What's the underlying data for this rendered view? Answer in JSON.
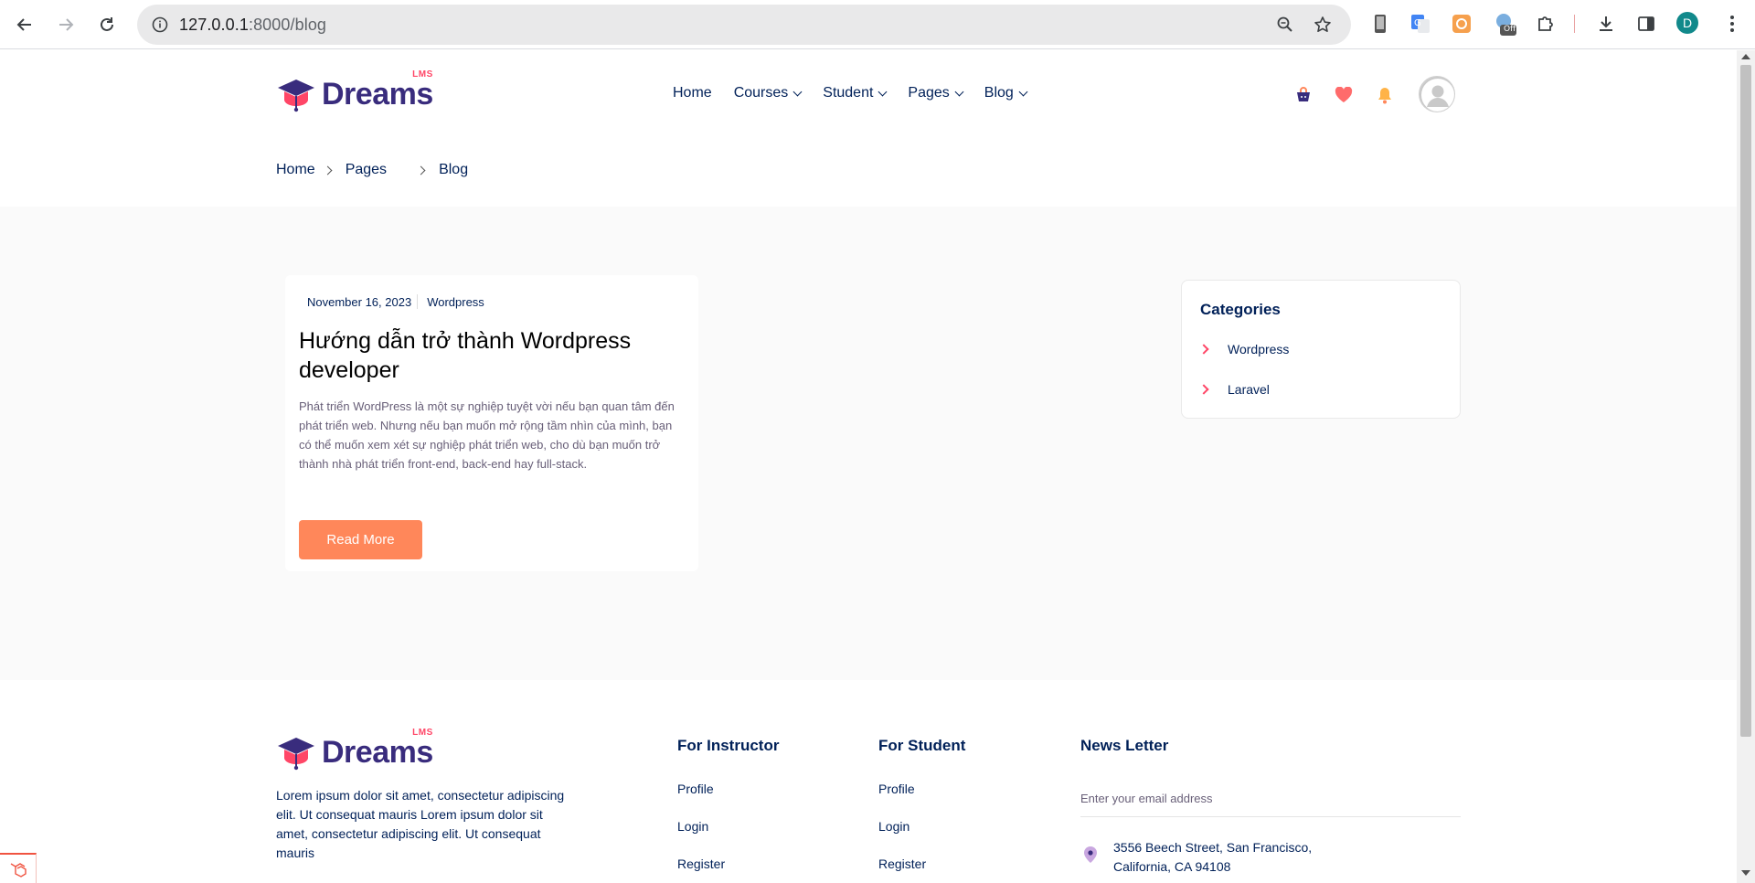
{
  "browser": {
    "url_host": "127.0.0.1",
    "url_path": ":8000/blog",
    "profile_initial": "D",
    "extension_badge": "Off"
  },
  "header": {
    "logo_text": "Dreams",
    "logo_badge": "LMS",
    "nav": [
      {
        "label": "Home"
      },
      {
        "label": "Courses"
      },
      {
        "label": "Student"
      },
      {
        "label": "Pages"
      },
      {
        "label": "Blog"
      }
    ]
  },
  "breadcrumb": [
    "Home",
    "Pages",
    "Blog"
  ],
  "post": {
    "date": "November 16, 2023",
    "category": "Wordpress",
    "title": "Hướng dẫn trở thành Wordpress developer",
    "excerpt": "Phát triển WordPress là một sự nghiệp tuyệt vời nếu bạn quan tâm đến phát triển web. Nhưng nếu bạn muốn mở rộng tầm nhìn của mình, bạn có thể muốn xem xét sự nghiệp phát triển web, cho dù bạn muốn trở thành nhà phát triển front-end, back-end hay full-stack.",
    "button": "Read More"
  },
  "categories": {
    "title": "Categories",
    "items": [
      "Wordpress",
      "Laravel"
    ]
  },
  "footer": {
    "logo_text": "Dreams",
    "logo_badge": "LMS",
    "description": "Lorem ipsum dolor sit amet, consectetur adipiscing elit. Ut consequat mauris Lorem ipsum dolor sit amet, consectetur adipiscing elit. Ut consequat mauris",
    "instructor": {
      "title": "For Instructor",
      "links": [
        "Profile",
        "Login",
        "Register"
      ]
    },
    "student": {
      "title": "For Student",
      "links": [
        "Profile",
        "Login",
        "Register"
      ]
    },
    "newsletter": {
      "title": "News Letter",
      "placeholder": "Enter your email address",
      "address_line1": "3556 Beech Street, San Francisco,",
      "address_line2": "California, CA 94108"
    }
  },
  "colors": {
    "brand_navy": "#392C7D",
    "brand_pink": "#FF4667",
    "button_orange": "#FF875A",
    "text_navy": "#002058"
  }
}
